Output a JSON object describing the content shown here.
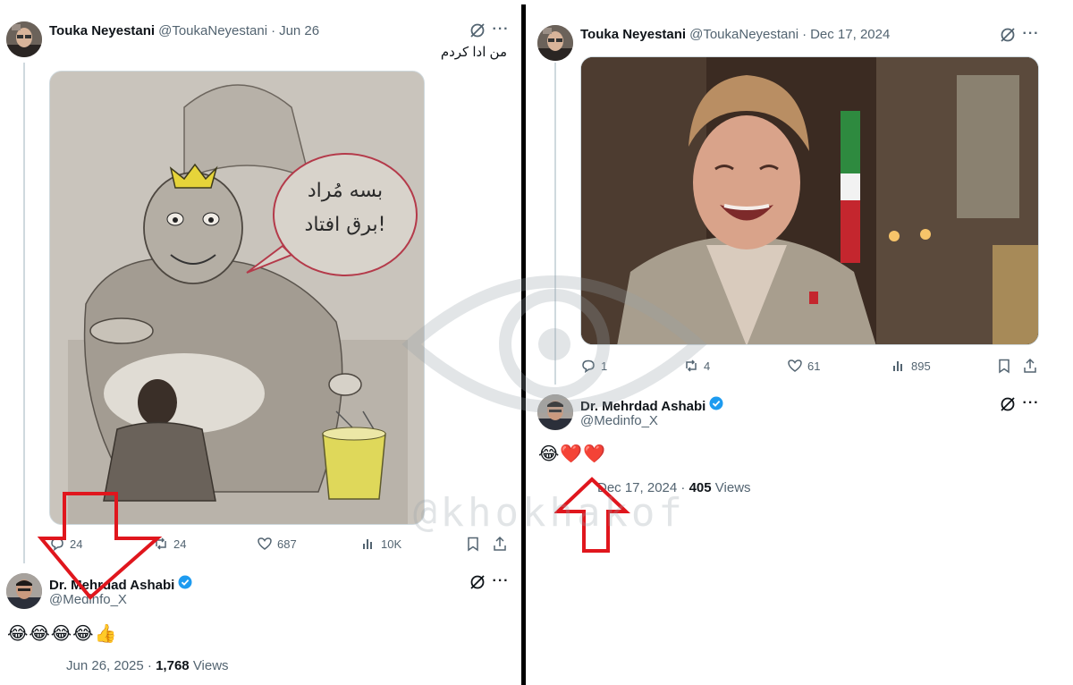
{
  "left": {
    "post": {
      "name": "Touka Neyestani",
      "handle": "@ToukaNeyestani",
      "separator": "·",
      "date": "Jun 26",
      "text": "من ادا کردم",
      "image_text_line1": "بسه مُراد",
      "image_text_line2": "برق افتاد!",
      "stats": {
        "replies": "24",
        "reposts": "24",
        "likes": "687",
        "views": "10K"
      }
    },
    "reply": {
      "name": "Dr. Mehrdad Ashabi",
      "handle": "@Medinfo_X",
      "emojis": "😂😂😂😂👍",
      "date": "Jun 26, 2025",
      "separator": "·",
      "views_count": "1,768",
      "views_label": "Views"
    }
  },
  "right": {
    "post": {
      "name": "Touka Neyestani",
      "handle": "@ToukaNeyestani",
      "separator": "·",
      "date": "Dec 17, 2024",
      "stats": {
        "replies": "1",
        "reposts": "4",
        "likes": "61",
        "views": "895"
      }
    },
    "reply": {
      "name": "Dr. Mehrdad Ashabi",
      "handle": "@Medinfo_X",
      "emojis": "😂❤️❤️",
      "date": "Dec 17, 2024",
      "separator": "·",
      "views_count": "405",
      "views_label": "Views"
    }
  },
  "watermark": "@khokhakof",
  "colors": {
    "secondary_text": "#536471",
    "verified_blue": "#1d9bf0",
    "arrow_red": "#e0161d",
    "divider": "#000000"
  },
  "icons": [
    "grok-icon",
    "more-icon",
    "reply-icon",
    "repost-icon",
    "like-icon",
    "views-icon",
    "bookmark-icon",
    "share-icon",
    "verified-badge-icon"
  ]
}
